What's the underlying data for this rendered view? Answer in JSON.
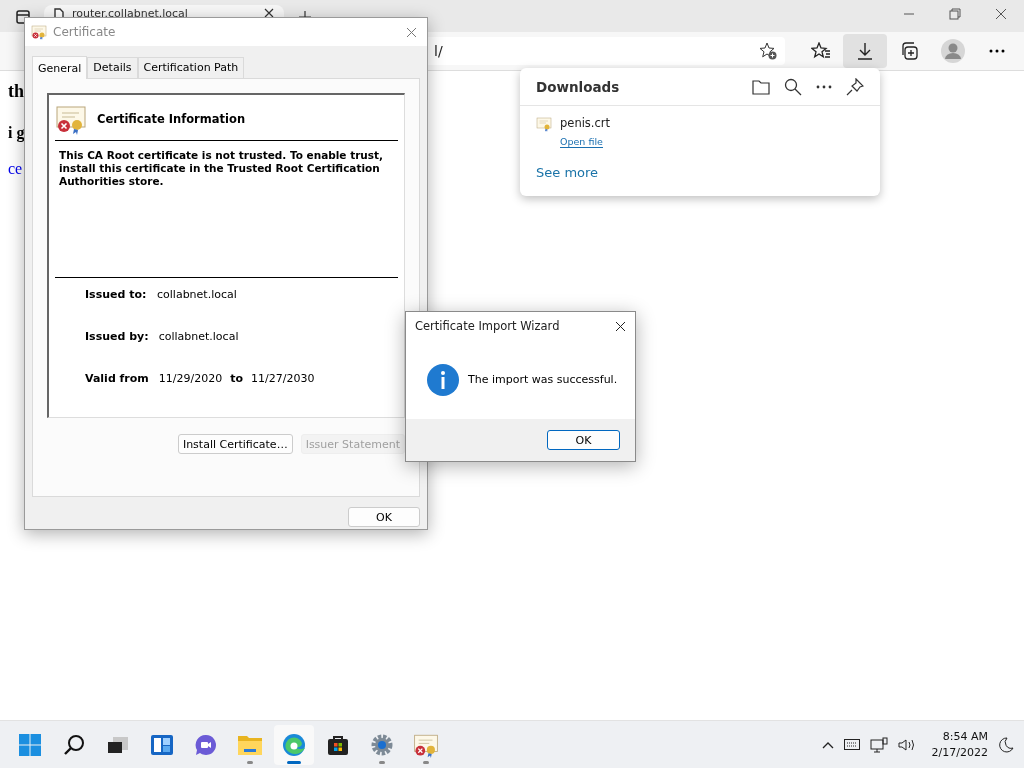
{
  "browser": {
    "tab_title": "router.collabnet.local",
    "address": "l/"
  },
  "page": {
    "heading": "th",
    "line": "i g",
    "link": "ce"
  },
  "downloads": {
    "title": "Downloads",
    "items": [
      {
        "name": "penis.crt",
        "action": "Open file"
      }
    ],
    "see_more": "See more"
  },
  "certificate_dialog": {
    "title": "Certificate",
    "tabs": [
      {
        "label": "General",
        "selected": true
      },
      {
        "label": "Details",
        "selected": false
      },
      {
        "label": "Certification Path",
        "selected": false
      }
    ],
    "info_title": "Certificate Information",
    "message": "This CA Root certificate is not trusted. To enable trust, install this certificate in the Trusted Root Certification Authorities store.",
    "fields": [
      {
        "label": "Issued to:",
        "value": "collabnet.local"
      },
      {
        "label": "Issued by:",
        "value": "collabnet.local"
      }
    ],
    "valid_from_label": "Valid from",
    "valid_from": "11/29/2020",
    "to_label": "to",
    "valid_to": "11/27/2030",
    "buttons": [
      {
        "label": "Install Certificate…",
        "disabled": false
      },
      {
        "label": "Issuer Statement",
        "disabled": true
      }
    ],
    "ok": "OK"
  },
  "wizard": {
    "title": "Certificate Import Wizard",
    "message": "The import was successful.",
    "ok": "OK"
  },
  "taskbar": {
    "apps": [
      {
        "kind": "start",
        "running": false,
        "selected": false
      },
      {
        "kind": "search",
        "running": false,
        "selected": false
      },
      {
        "kind": "taskview",
        "running": false,
        "selected": false
      },
      {
        "kind": "widgets",
        "running": false,
        "selected": false
      },
      {
        "kind": "chat",
        "running": false,
        "selected": false
      },
      {
        "kind": "explorer",
        "running": true,
        "selected": false
      },
      {
        "kind": "edge",
        "running": true,
        "selected": true
      },
      {
        "kind": "store",
        "running": false,
        "selected": false
      },
      {
        "kind": "settings",
        "running": true,
        "selected": false
      },
      {
        "kind": "certificate",
        "running": true,
        "selected": false
      }
    ],
    "time": "8:54 AM",
    "date": "2/17/2022"
  }
}
